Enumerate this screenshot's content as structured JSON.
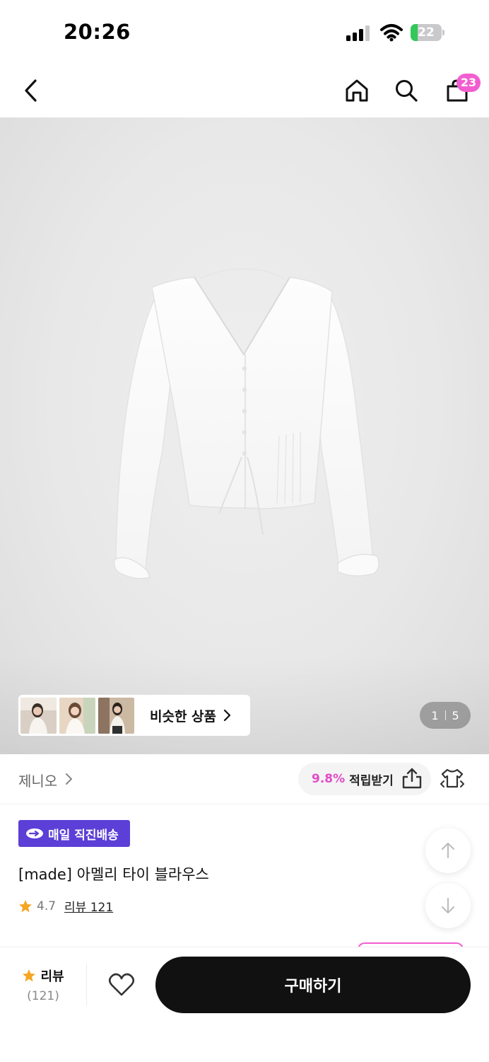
{
  "status_bar": {
    "time": "20:26",
    "battery_percent": "22",
    "battery_level": 0.22
  },
  "nav": {
    "cart_count": "23"
  },
  "gallery": {
    "similar_label": "비슷한 상품",
    "page_current": "1",
    "page_total": "5"
  },
  "brand": {
    "name": "제니오",
    "points_rate": "9.8%",
    "points_label": "적립받기"
  },
  "product": {
    "badge": "매일 직진배송",
    "title": "[made] 아멜리 타이 블라우스",
    "rating": "4.7",
    "review_link": "리뷰 121"
  },
  "bottom_bar": {
    "review_label": "리뷰",
    "review_count": "(121)",
    "buy_label": "구매하기"
  },
  "colors": {
    "accent_pink": "#f25ed0",
    "badge_purple": "#5b3fd6",
    "points_pink": "#e24bc6",
    "buy_black": "#111111",
    "star": "#f5a623"
  }
}
